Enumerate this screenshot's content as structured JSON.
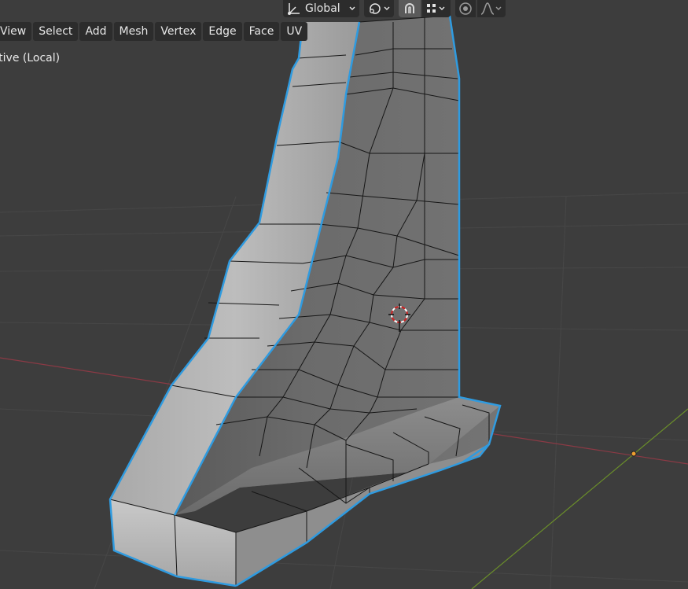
{
  "header": {
    "transform_orientation": "Global",
    "menus": [
      {
        "id": "view",
        "label": "View"
      },
      {
        "id": "select",
        "label": "Select"
      },
      {
        "id": "add",
        "label": "Add"
      },
      {
        "id": "mesh",
        "label": "Mesh"
      },
      {
        "id": "vertex",
        "label": "Vertex"
      },
      {
        "id": "edge",
        "label": "Edge"
      },
      {
        "id": "face",
        "label": "Face"
      },
      {
        "id": "uv",
        "label": "UV"
      }
    ]
  },
  "viewport": {
    "context_label": "User Perspective (Local)"
  },
  "icons": {
    "orientation": "transform-orientation-icon",
    "pivot": "pivot-point-icon",
    "snap": "snap-magnet-icon",
    "snap_target": "snap-increment-icon",
    "proportional": "proportional-editing-icon",
    "falloff": "falloff-curve-icon"
  },
  "colors": {
    "background": "#3d3d3d",
    "grid": "#474747",
    "x_axis": "#8b3a45",
    "y_axis": "#6b8f2a",
    "selection_outline": "#2f9be0",
    "header_button": "#2c2c2c",
    "text": "#e6e6e6"
  }
}
